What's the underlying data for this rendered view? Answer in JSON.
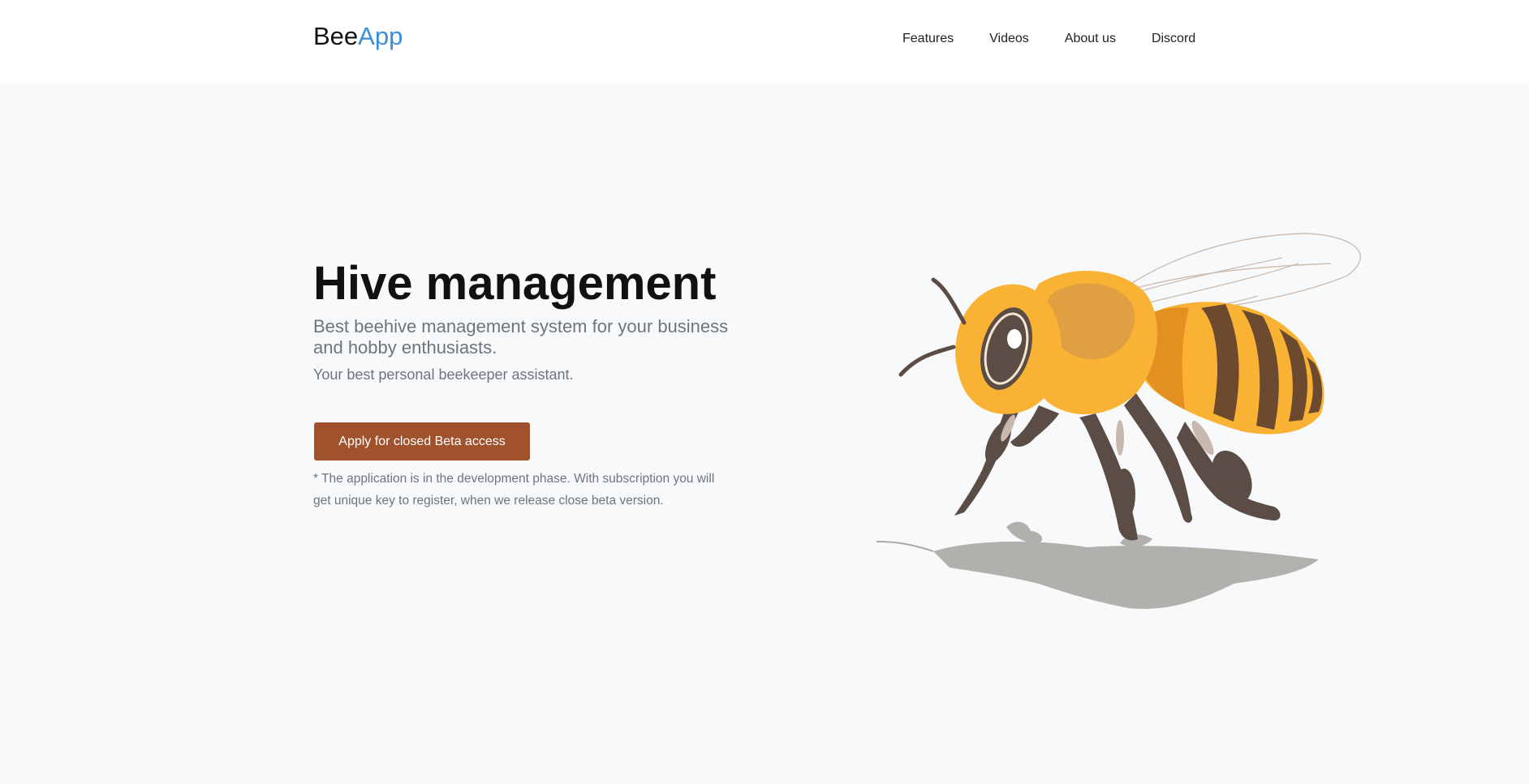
{
  "header": {
    "logo_part1": "Bee",
    "logo_part2": "App",
    "nav": [
      "Features",
      "Videos",
      "About us",
      "Discord"
    ]
  },
  "hero": {
    "title": "Hive management",
    "subtitle": "Best beehive management system for your business and hobby enthusiasts.",
    "tagline": "Your best personal beekeeper assistant.",
    "cta_label": "Apply for closed Beta access",
    "note": "* The application is in the development phase. With subscription you will get unique key to register, when we release close beta version."
  },
  "illustration": {
    "icon": "bee-illustration",
    "colors": {
      "body": "#f9b233",
      "body_dark": "#e08a1e",
      "stripe": "#6b4a2f",
      "legs": "#5b4d45",
      "shadow": "#a9aaa4",
      "wing": "#c9b7a8"
    }
  },
  "theme": {
    "accent": "#3b8ed8",
    "button": "#a0522d",
    "background": "#f8f9fa"
  }
}
